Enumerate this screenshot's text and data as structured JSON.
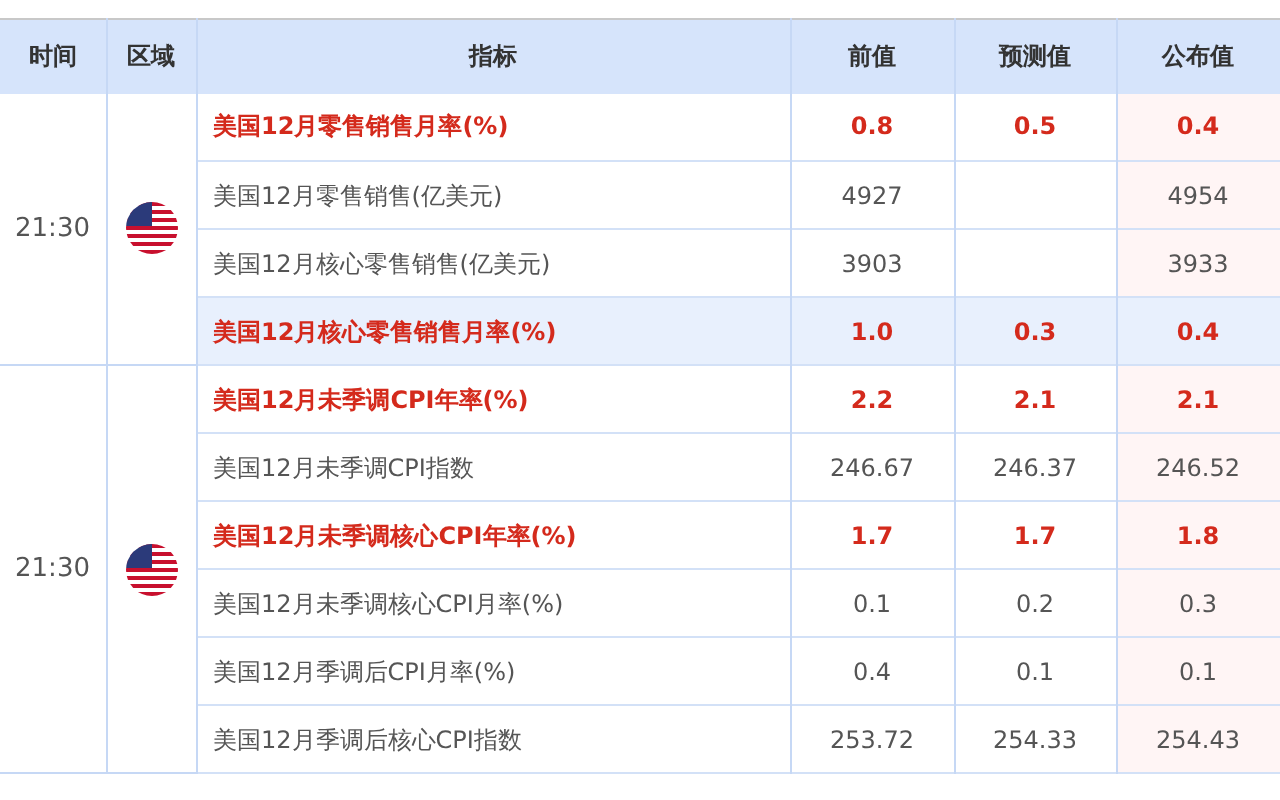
{
  "table": {
    "columns": [
      "时间",
      "区域",
      "指标",
      "前值",
      "预测值",
      "公布值"
    ],
    "groups": [
      {
        "time": "21:30",
        "rows": [
          {
            "indicator": "美国12月零售销售月率(%)",
            "previous": "0.8",
            "forecast": "0.5",
            "actual": "0.4",
            "important": true,
            "highlighted": false
          },
          {
            "indicator": "美国12月零售销售(亿美元)",
            "previous": "4927",
            "forecast": "",
            "actual": "4954",
            "important": false,
            "highlighted": false
          },
          {
            "indicator": "美国12月核心零售销售(亿美元)",
            "previous": "3903",
            "forecast": "",
            "actual": "3933",
            "important": false,
            "highlighted": false
          },
          {
            "indicator": "美国12月核心零售销售月率(%)",
            "previous": "1.0",
            "forecast": "0.3",
            "actual": "0.4",
            "important": true,
            "highlighted": true
          }
        ]
      },
      {
        "time": "21:30",
        "rows": [
          {
            "indicator": "美国12月未季调CPI年率(%)",
            "previous": "2.2",
            "forecast": "2.1",
            "actual": "2.1",
            "important": true,
            "highlighted": false
          },
          {
            "indicator": "美国12月未季调CPI指数",
            "previous": "246.67",
            "forecast": "246.37",
            "actual": "246.52",
            "important": false,
            "highlighted": false
          },
          {
            "indicator": "美国12月未季调核心CPI年率(%)",
            "previous": "1.7",
            "forecast": "1.7",
            "actual": "1.8",
            "important": true,
            "highlighted": false
          },
          {
            "indicator": "美国12月未季调核心CPI月率(%)",
            "previous": "0.1",
            "forecast": "0.2",
            "actual": "0.3",
            "important": false,
            "highlighted": false
          },
          {
            "indicator": "美国12月季调后CPI月率(%)",
            "previous": "0.4",
            "forecast": "0.1",
            "actual": "0.1",
            "important": false,
            "highlighted": false
          },
          {
            "indicator": "美国12月季调后核心CPI指数",
            "previous": "253.72",
            "forecast": "254.33",
            "actual": "254.43",
            "important": false,
            "highlighted": false
          }
        ]
      }
    ]
  }
}
